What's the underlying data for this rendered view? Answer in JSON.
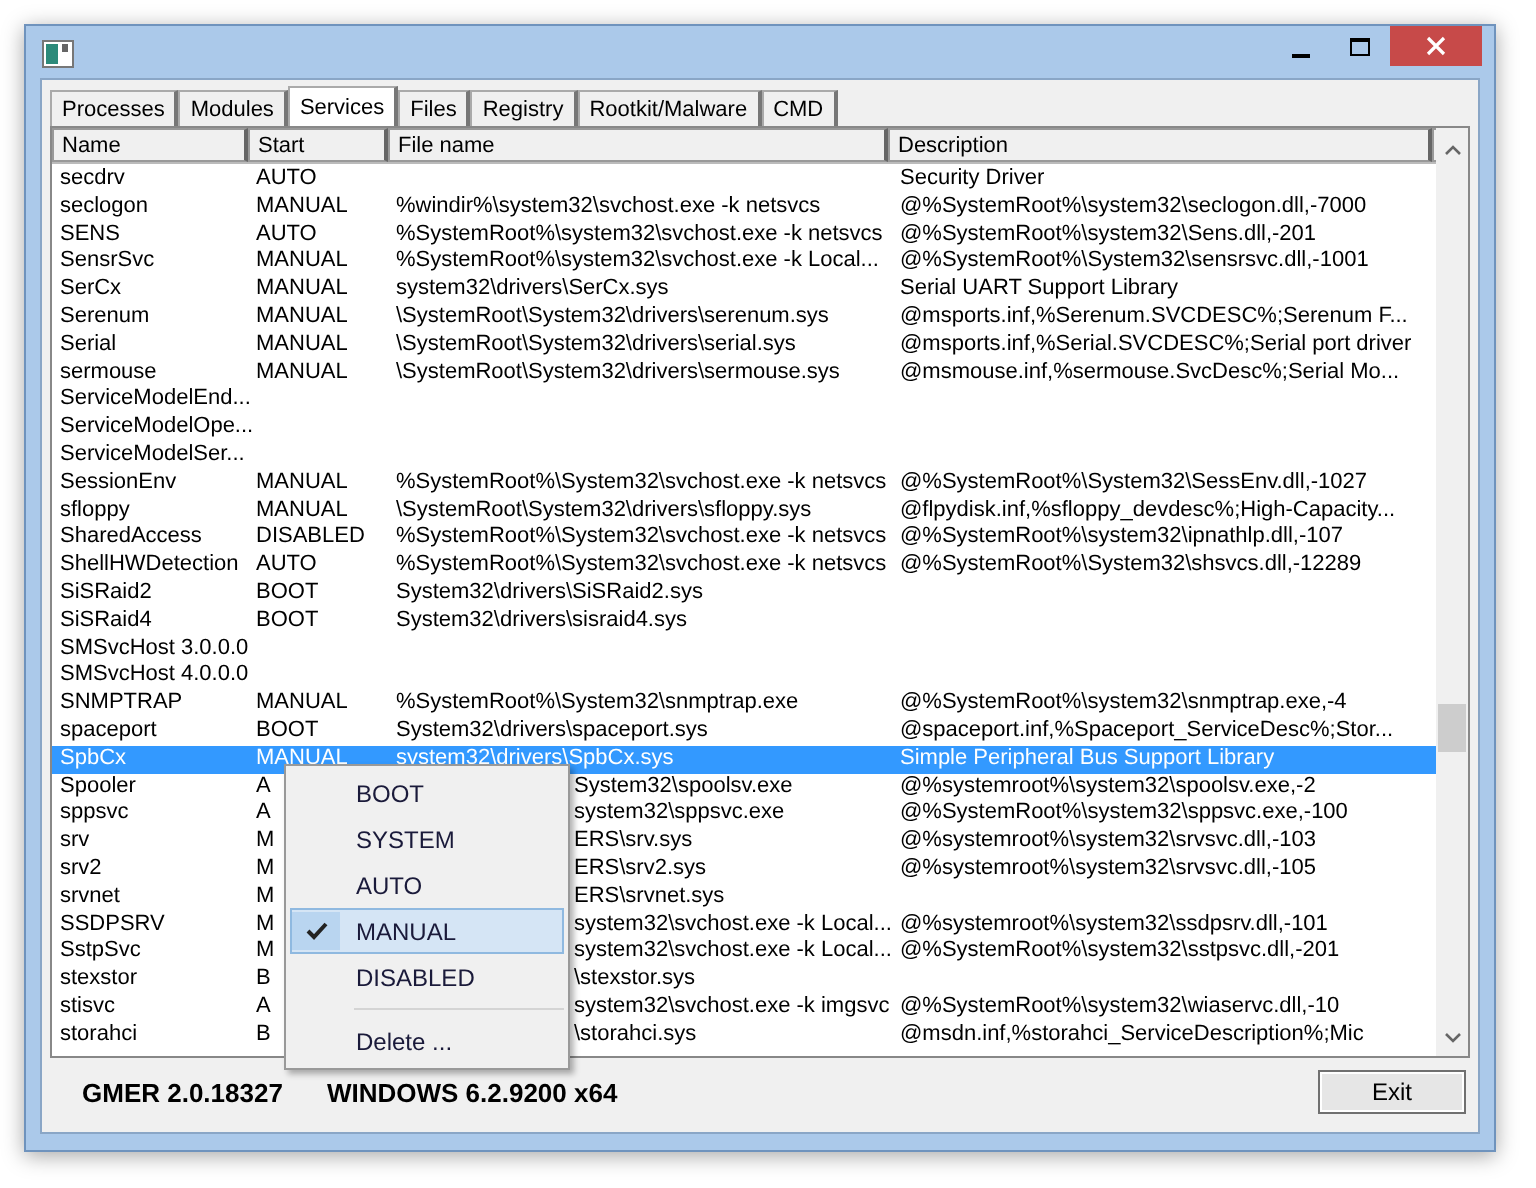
{
  "tabs": [
    {
      "label": "Processes",
      "selected": false
    },
    {
      "label": "Modules",
      "selected": false
    },
    {
      "label": "Services",
      "selected": true
    },
    {
      "label": "Files",
      "selected": false
    },
    {
      "label": "Registry",
      "selected": false
    },
    {
      "label": "Rootkit/Malware",
      "selected": false
    },
    {
      "label": "CMD",
      "selected": false
    }
  ],
  "table": {
    "columns": [
      "Name",
      "Start",
      "File name",
      "Description"
    ],
    "rows": [
      {
        "cells": [
          "secdrv",
          "AUTO",
          "",
          "Security Driver"
        ],
        "selected": false
      },
      {
        "cells": [
          "seclogon",
          "MANUAL",
          "%windir%\\system32\\svchost.exe -k netsvcs",
          "@%SystemRoot%\\system32\\seclogon.dll,-7000"
        ],
        "selected": false
      },
      {
        "cells": [
          "SENS",
          "AUTO",
          "%SystemRoot%\\system32\\svchost.exe -k netsvcs",
          "@%SystemRoot%\\system32\\Sens.dll,-201"
        ],
        "selected": false
      },
      {
        "cells": [
          "SensrSvc",
          "MANUAL",
          "%SystemRoot%\\system32\\svchost.exe -k Local...",
          "@%SystemRoot%\\System32\\sensrsvc.dll,-1001"
        ],
        "selected": false
      },
      {
        "cells": [
          "SerCx",
          "MANUAL",
          "system32\\drivers\\SerCx.sys",
          "Serial UART Support Library"
        ],
        "selected": false
      },
      {
        "cells": [
          "Serenum",
          "MANUAL",
          "\\SystemRoot\\System32\\drivers\\serenum.sys",
          "@msports.inf,%Serenum.SVCDESC%;Serenum F..."
        ],
        "selected": false
      },
      {
        "cells": [
          "Serial",
          "MANUAL",
          "\\SystemRoot\\System32\\drivers\\serial.sys",
          "@msports.inf,%Serial.SVCDESC%;Serial port driver"
        ],
        "selected": false
      },
      {
        "cells": [
          "sermouse",
          "MANUAL",
          "\\SystemRoot\\System32\\drivers\\sermouse.sys",
          "@msmouse.inf,%sermouse.SvcDesc%;Serial Mo..."
        ],
        "selected": false
      },
      {
        "cells": [
          "ServiceModelEnd...",
          "",
          "",
          ""
        ],
        "selected": false
      },
      {
        "cells": [
          "ServiceModelOpe...",
          "",
          "",
          ""
        ],
        "selected": false
      },
      {
        "cells": [
          "ServiceModelSer...",
          "",
          "",
          ""
        ],
        "selected": false
      },
      {
        "cells": [
          "SessionEnv",
          "MANUAL",
          "%SystemRoot%\\System32\\svchost.exe -k netsvcs",
          "@%SystemRoot%\\System32\\SessEnv.dll,-1027"
        ],
        "selected": false
      },
      {
        "cells": [
          "sfloppy",
          "MANUAL",
          "\\SystemRoot\\System32\\drivers\\sfloppy.sys",
          "@flpydisk.inf,%sfloppy_devdesc%;High-Capacity..."
        ],
        "selected": false
      },
      {
        "cells": [
          "SharedAccess",
          "DISABLED",
          "%SystemRoot%\\System32\\svchost.exe -k netsvcs",
          "@%SystemRoot%\\system32\\ipnathlp.dll,-107"
        ],
        "selected": false
      },
      {
        "cells": [
          "ShellHWDetection",
          "AUTO",
          "%SystemRoot%\\System32\\svchost.exe -k netsvcs",
          "@%SystemRoot%\\System32\\shsvcs.dll,-12289"
        ],
        "selected": false
      },
      {
        "cells": [
          "SiSRaid2",
          "BOOT",
          "System32\\drivers\\SiSRaid2.sys",
          ""
        ],
        "selected": false
      },
      {
        "cells": [
          "SiSRaid4",
          "BOOT",
          "System32\\drivers\\sisraid4.sys",
          ""
        ],
        "selected": false
      },
      {
        "cells": [
          "SMSvcHost 3.0.0.0",
          "",
          "",
          ""
        ],
        "selected": false
      },
      {
        "cells": [
          "SMSvcHost 4.0.0.0",
          "",
          "",
          ""
        ],
        "selected": false
      },
      {
        "cells": [
          "SNMPTRAP",
          "MANUAL",
          "%SystemRoot%\\System32\\snmptrap.exe",
          "@%SystemRoot%\\system32\\snmptrap.exe,-4"
        ],
        "selected": false
      },
      {
        "cells": [
          "spaceport",
          "BOOT",
          "System32\\drivers\\spaceport.sys",
          "@spaceport.inf,%Spaceport_ServiceDesc%;Stor..."
        ],
        "selected": false
      },
      {
        "cells": [
          "SpbCx",
          "MANUAL",
          "system32\\drivers\\SpbCx.sys",
          "Simple Peripheral Bus Support Library"
        ],
        "selected": true
      },
      {
        "cells": [
          "Spooler",
          "A",
          "System32\\spoolsv.exe",
          "@%systemroot%\\system32\\spoolsv.exe,-2"
        ],
        "selected": false,
        "kind": "covered"
      },
      {
        "cells": [
          "sppsvc",
          "A",
          "system32\\sppsvc.exe",
          "@%SystemRoot%\\system32\\sppsvc.exe,-100"
        ],
        "selected": false,
        "kind": "covered"
      },
      {
        "cells": [
          "srv",
          "M",
          "ERS\\srv.sys",
          "@%systemroot%\\system32\\srvsvc.dll,-103"
        ],
        "selected": false,
        "kind": "covered"
      },
      {
        "cells": [
          "srv2",
          "M",
          "ERS\\srv2.sys",
          "@%systemroot%\\system32\\srvsvc.dll,-105"
        ],
        "selected": false,
        "kind": "covered"
      },
      {
        "cells": [
          "srvnet",
          "M",
          "ERS\\srvnet.sys",
          ""
        ],
        "selected": false,
        "kind": "covered"
      },
      {
        "cells": [
          "SSDPSRV",
          "M",
          "system32\\svchost.exe -k Local...",
          "@%systemroot%\\system32\\ssdpsrv.dll,-101"
        ],
        "selected": false,
        "kind": "covered"
      },
      {
        "cells": [
          "SstpSvc",
          "M",
          "system32\\svchost.exe -k Local...",
          "@%SystemRoot%\\system32\\sstpsvc.dll,-201"
        ],
        "selected": false,
        "kind": "covered"
      },
      {
        "cells": [
          "stexstor",
          "B",
          "\\stexstor.sys",
          ""
        ],
        "selected": false,
        "kind": "covered"
      },
      {
        "cells": [
          "stisvc",
          "A",
          "system32\\svchost.exe -k imgsvc",
          "@%SystemRoot%\\system32\\wiaservc.dll,-10"
        ],
        "selected": false,
        "kind": "covered"
      },
      {
        "cells": [
          "storahci",
          "B",
          "\\storahci.sys",
          "@msdn.inf,%storahci_ServiceDescription%;Mic"
        ],
        "selected": false,
        "kind": "covered"
      }
    ]
  },
  "context_menu": {
    "items": [
      {
        "kind": "option",
        "label": "BOOT",
        "checked": false,
        "selected": false
      },
      {
        "kind": "option",
        "label": "SYSTEM",
        "checked": false,
        "selected": false
      },
      {
        "kind": "option",
        "label": "AUTO",
        "checked": false,
        "selected": false
      },
      {
        "kind": "option",
        "label": "MANUAL",
        "checked": true,
        "selected": true
      },
      {
        "kind": "option",
        "label": "DISABLED",
        "checked": false,
        "selected": false
      },
      {
        "kind": "separator"
      },
      {
        "kind": "option",
        "label": "Delete ...",
        "checked": false,
        "selected": false
      }
    ]
  },
  "status_bar": {
    "version": "GMER 2.0.18327",
    "system": "WINDOWS 6.2.9200  x64"
  },
  "buttons": [
    "Exit"
  ]
}
